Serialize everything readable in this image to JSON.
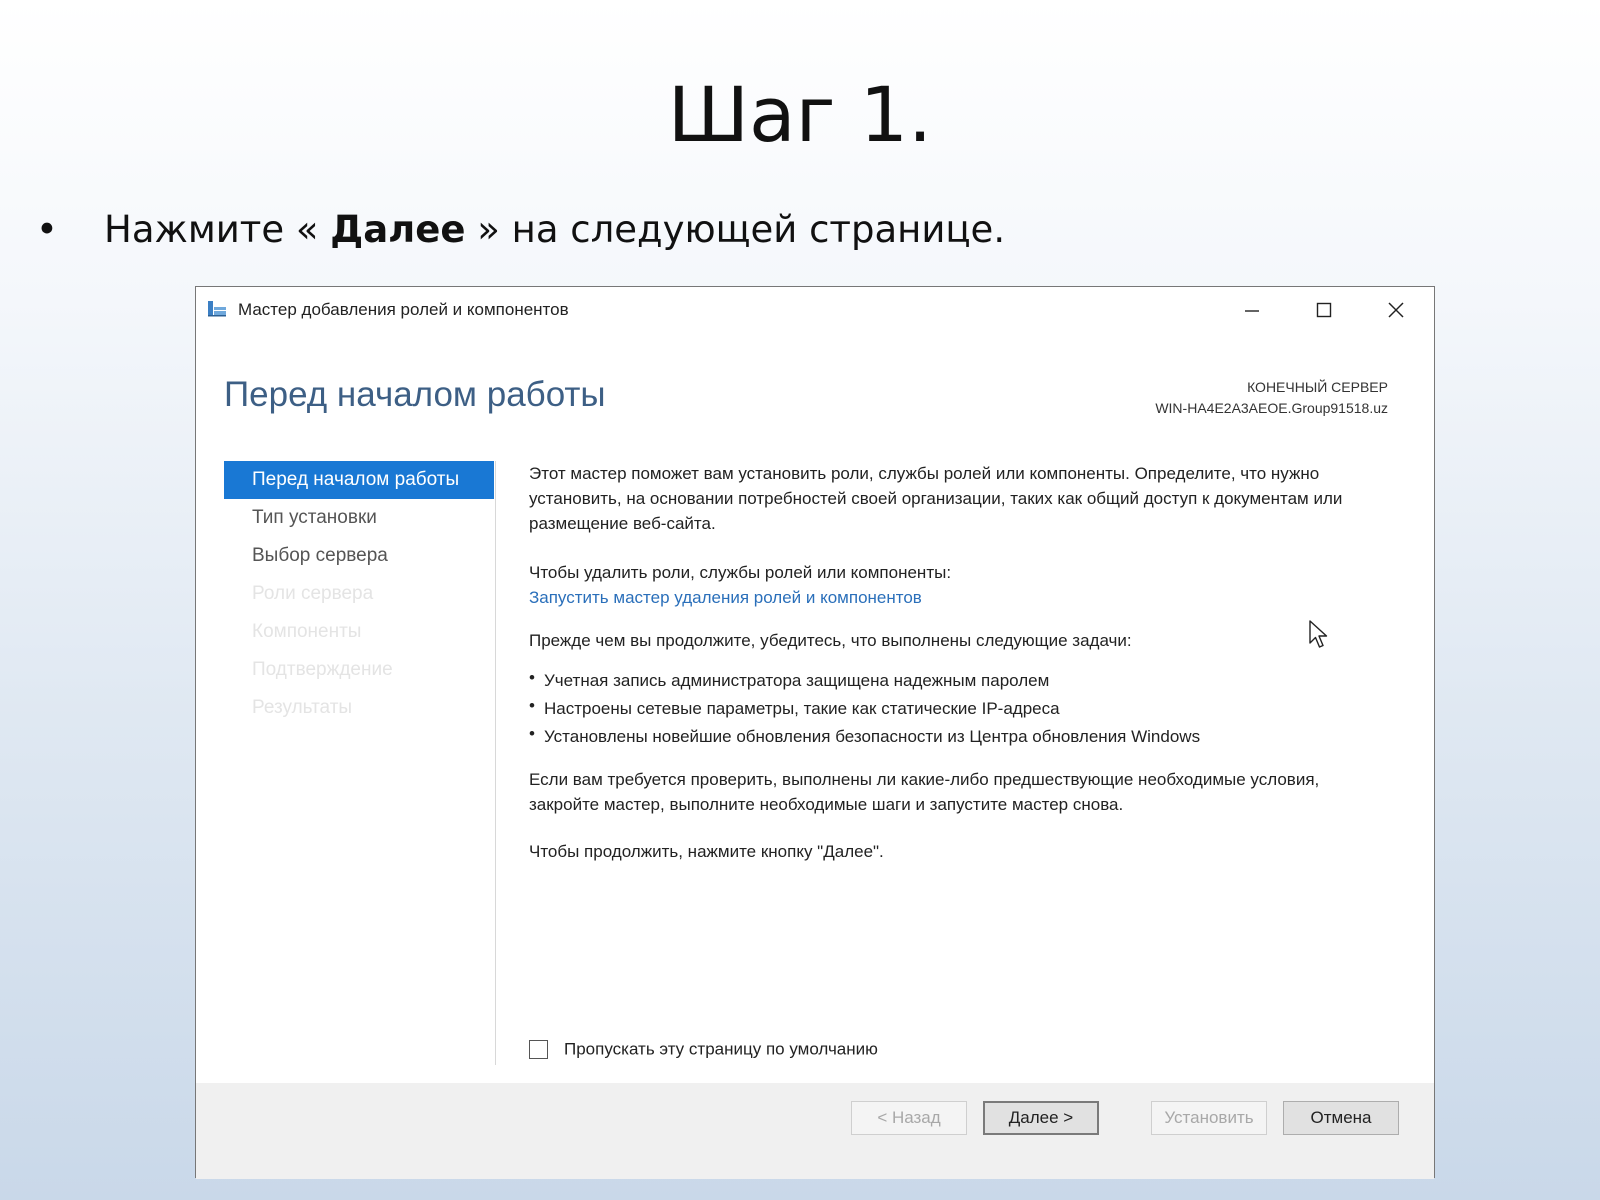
{
  "slide": {
    "title": "Шаг 1.",
    "bullet_before": "Нажмите « ",
    "bullet_bold": "Далее",
    "bullet_after": " » на следующей странице."
  },
  "window": {
    "title": "Мастер добавления ролей и компонентов",
    "heading": "Перед началом работы",
    "server_label": "КОНЕЧНЫЙ СЕРВЕР",
    "server_name": "WIN-HA4E2A3AEOE.Group91518.uz"
  },
  "nav": {
    "items": [
      {
        "label": "Перед началом работы"
      },
      {
        "label": "Тип установки"
      },
      {
        "label": "Выбор сервера"
      },
      {
        "label": "Роли сервера"
      },
      {
        "label": "Компоненты"
      },
      {
        "label": "Подтверждение"
      },
      {
        "label": "Результаты"
      }
    ]
  },
  "content": {
    "intro": "Этот мастер поможет вам установить роли, службы ролей или компоненты. Определите, что нужно установить, на основании потребностей своей организации, таких как общий доступ к документам или размещение веб-сайта.",
    "remove_prompt": "Чтобы удалить роли, службы ролей или компоненты:",
    "remove_link": "Запустить мастер удаления ролей и компонентов",
    "before_continue": "Прежде чем вы продолжите, убедитесь, что выполнены следующие задачи:",
    "tasks": [
      "Учетная запись администратора защищена надежным паролем",
      "Настроены сетевые параметры, такие как статические IP-адреса",
      "Установлены новейшие обновления безопасности из Центра обновления Windows"
    ],
    "prereq_note": "Если вам требуется проверить, выполнены ли какие-либо предшествующие необходимые условия, закройте мастер, выполните необходимые шаги и запустите мастер снова.",
    "continue_note": "Чтобы продолжить, нажмите кнопку \"Далее\".",
    "skip_label": "Пропускать эту страницу по умолчанию"
  },
  "buttons": {
    "back": "< Назад",
    "next": "Далее >",
    "install": "Установить",
    "cancel": "Отмена"
  },
  "colors": {
    "accent": "#1978d4",
    "heading": "#3d5f85",
    "link": "#2a6fba"
  }
}
